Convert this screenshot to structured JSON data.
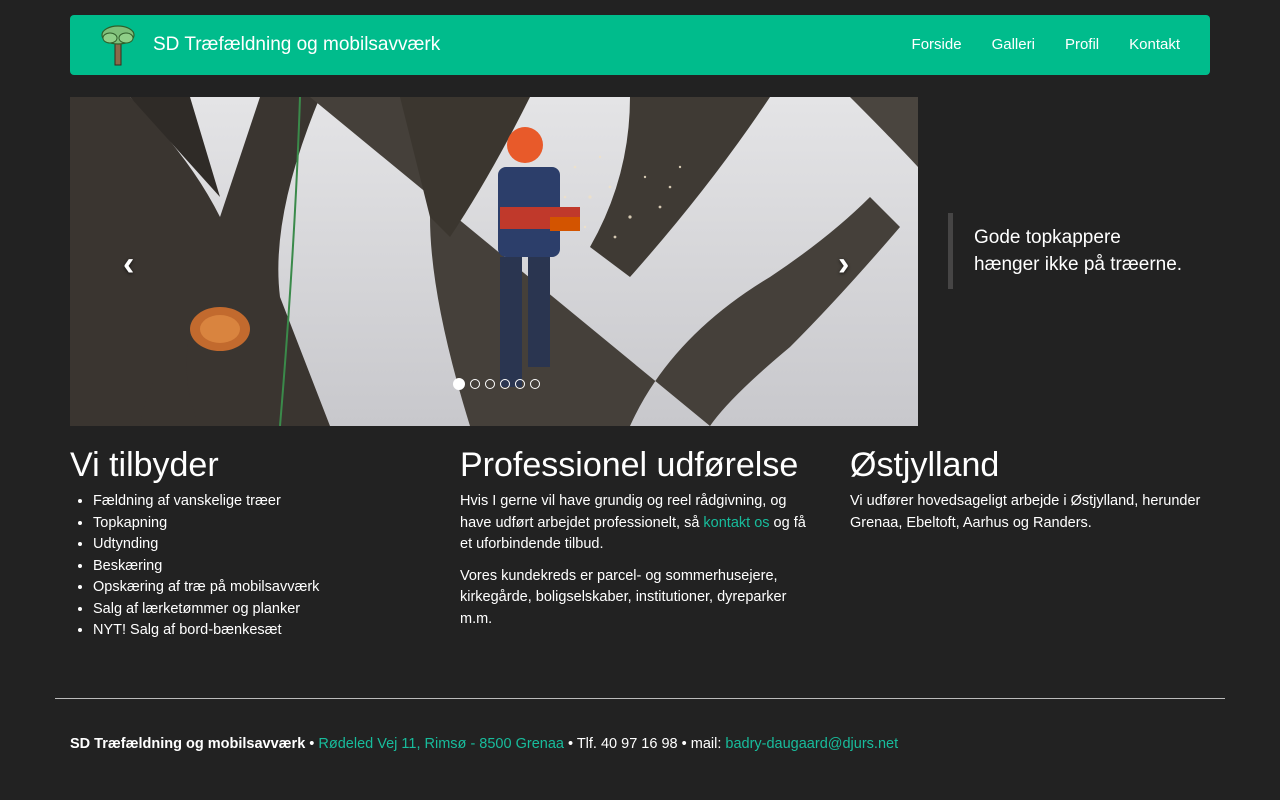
{
  "nav": {
    "brand": "SD Træfældning og mobilsavværk",
    "links": [
      "Forside",
      "Galleri",
      "Profil",
      "Kontakt"
    ]
  },
  "carousel": {
    "prev_glyph": "‹",
    "next_glyph": "›",
    "slide_count": 6,
    "active_slide": 1
  },
  "quote": {
    "line1": "Gode topkappere",
    "line2": "hænger ikke på træerne."
  },
  "columns": {
    "offer": {
      "heading": "Vi tilbyder",
      "items": [
        "Fældning af vanskelige træer",
        "Topkapning",
        "Udtynding",
        "Beskæring",
        "Opskæring af træ på mobilsavværk",
        "Salg af lærketømmer og planker",
        "NYT! Salg af bord-bænkesæt"
      ]
    },
    "pro": {
      "heading": "Professionel udførelse",
      "p1_before": "Hvis I gerne vil have grundig og reel rådgivning, og have udført arbejdet professionelt, så ",
      "p1_link": "kontakt os",
      "p1_after": " og få et uforbindende tilbud.",
      "p2": "Vores kundekreds er parcel- og sommerhusejere, kirkegårde, boligselskaber, institutioner, dyreparker m.m."
    },
    "region": {
      "heading": "Østjylland",
      "text": "Vi udfører hovedsageligt arbejde i Østjylland, herunder Grenaa, Ebeltoft, Aarhus og Randers."
    }
  },
  "footer": {
    "company": "SD Træfældning og mobilsavværk",
    "sep": " • ",
    "address": "Rødeled Vej 11, Rimsø - 8500 Grenaa",
    "phone": "Tlf. 40 97 16 98",
    "mail_label": "mail:",
    "email": "badry-daugaard@djurs.net"
  },
  "colors": {
    "background": "#222222",
    "navbar": "#00bc8c",
    "link": "#18bc9c",
    "text": "#ffffff"
  },
  "icons": {
    "logo": "tree-logo-icon",
    "prev": "chevron-left-icon",
    "next": "chevron-right-icon"
  }
}
